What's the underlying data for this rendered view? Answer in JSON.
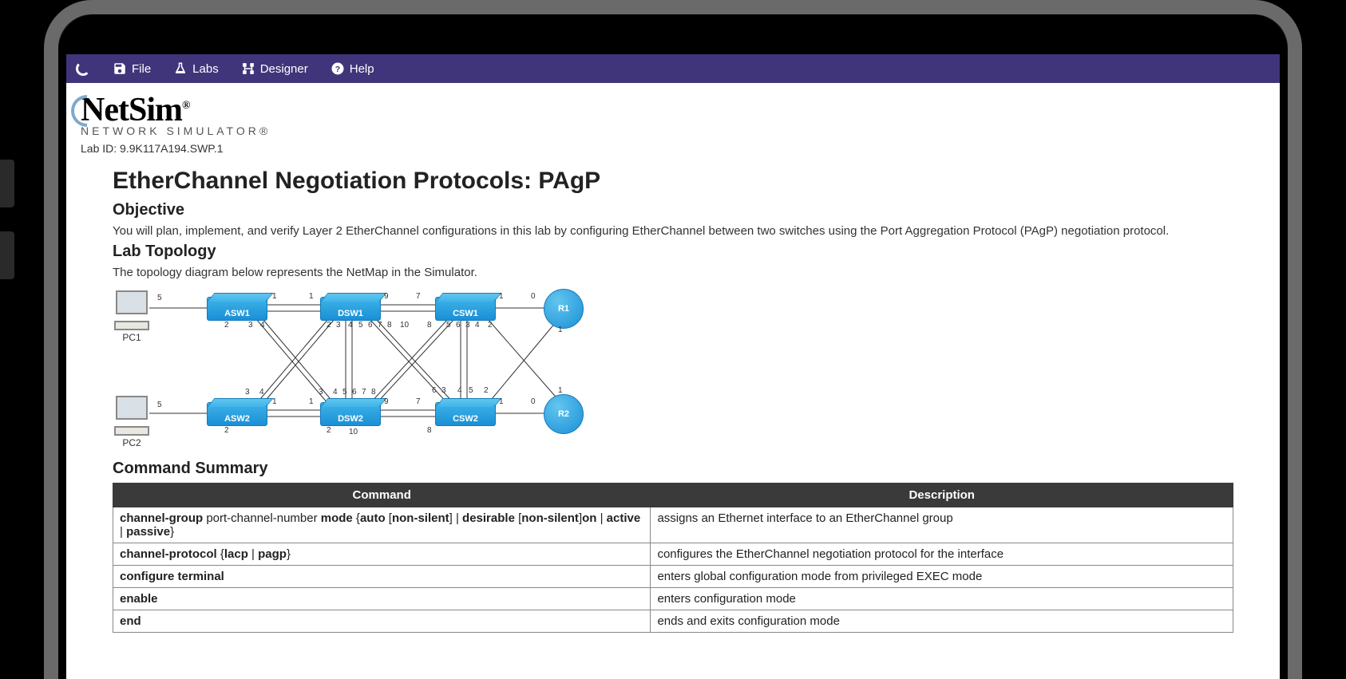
{
  "menu": {
    "file": "File",
    "labs": "Labs",
    "designer": "Designer",
    "help": "Help"
  },
  "logo": {
    "main": "NetSim",
    "registered": "®",
    "sub": "NETWORK SIMULATOR®"
  },
  "lab_id_label": "Lab ID: ",
  "lab_id": "9.9K117A194.SWP.1",
  "title": "EtherChannel Negotiation Protocols: PAgP",
  "objective_heading": "Objective",
  "objective_text": "You will plan, implement, and verify Layer 2 EtherChannel configurations in this lab by configuring EtherChannel between two switches using the Port Aggregation Protocol (PAgP) negotiation protocol.",
  "topology_heading": "Lab Topology",
  "topology_text": "The topology diagram below represents the NetMap in the Simulator.",
  "devices": {
    "pc1": "PC1",
    "pc2": "PC2",
    "asw1": "ASW1",
    "asw2": "ASW2",
    "dsw1": "DSW1",
    "dsw2": "DSW2",
    "csw1": "CSW1",
    "csw2": "CSW2",
    "r1": "R1",
    "r2": "R2"
  },
  "cmd_heading": "Command Summary",
  "table": {
    "th_cmd": "Command",
    "th_desc": "Description",
    "rows": [
      {
        "cmd_html": "<b>channel-group</b> port-channel-number <b>mode</b> {<b>auto</b> [<b>non-silent</b>] | <b>desirable</b> [<b>non-silent</b>]<b>on</b> | <b>active</b> | <b>passive</b>}",
        "desc": "assigns an Ethernet interface to an EtherChannel group"
      },
      {
        "cmd_html": "<b>channel-protocol</b> {<b>lacp</b> | <b>pagp</b>}",
        "desc": "configures the EtherChannel negotiation protocol for the interface"
      },
      {
        "cmd_html": "<b>configure terminal</b>",
        "desc": "enters global configuration mode from privileged EXEC mode"
      },
      {
        "cmd_html": "<b>enable</b>",
        "desc": "enters configuration mode"
      },
      {
        "cmd_html": "<b>end</b>",
        "desc": "ends and exits configuration mode"
      }
    ]
  }
}
